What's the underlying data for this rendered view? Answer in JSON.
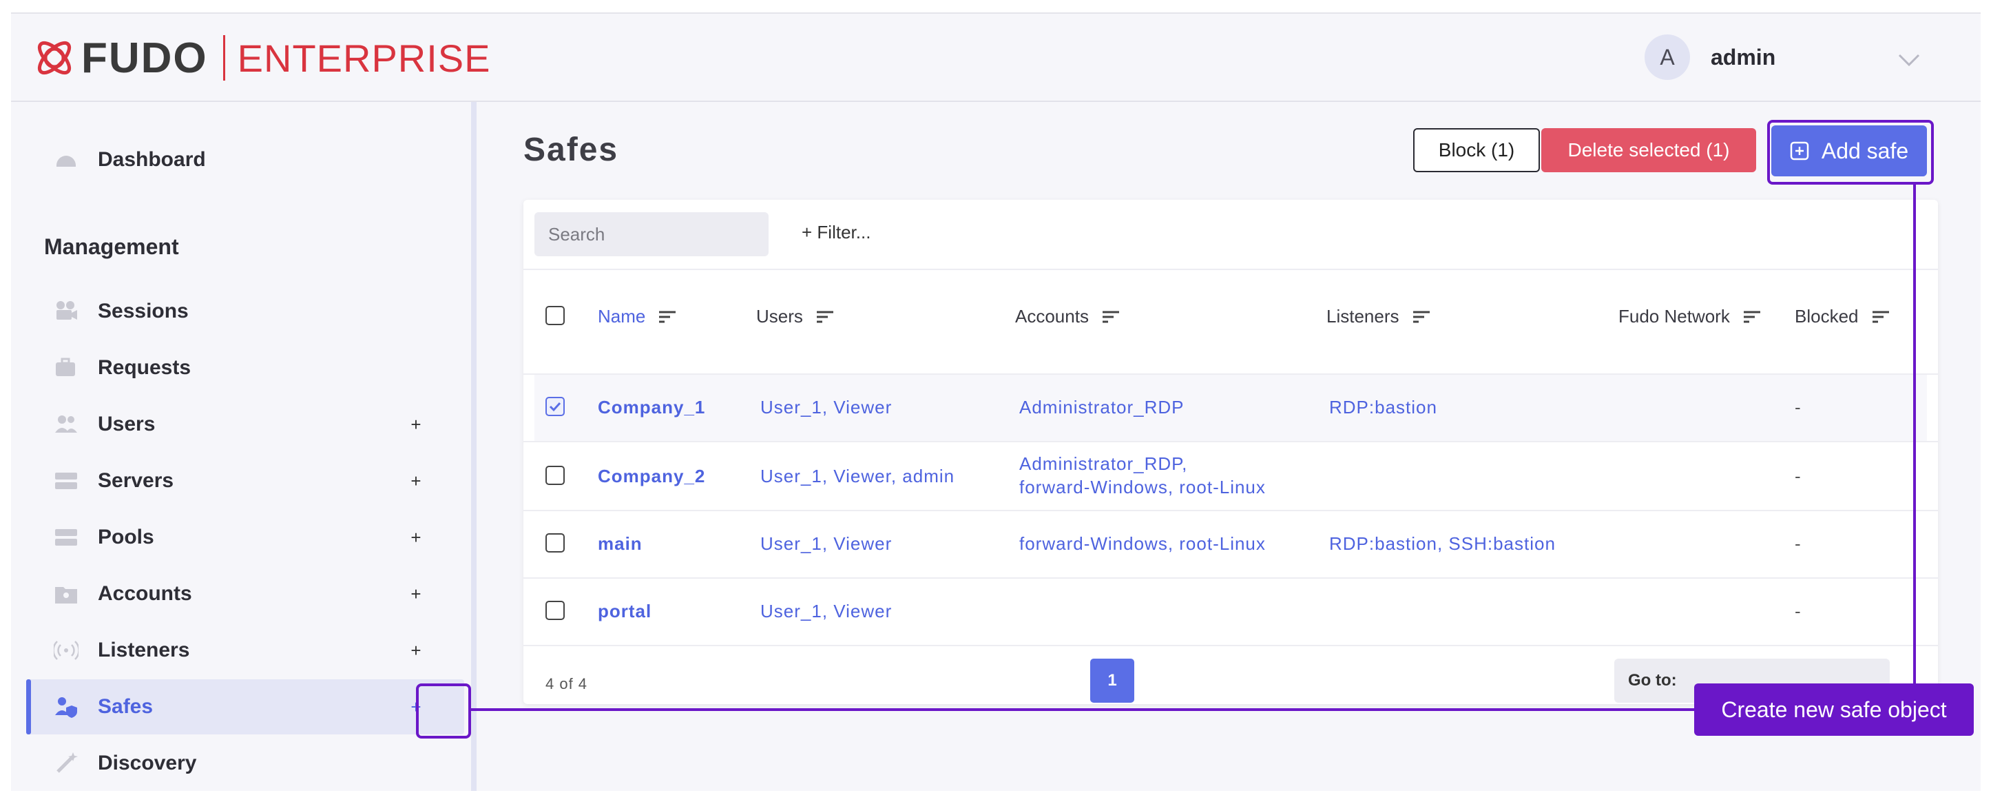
{
  "brand": {
    "name": "FUDO",
    "edition": "ENTERPRISE"
  },
  "user": {
    "initial": "A",
    "name": "admin"
  },
  "sidebar": {
    "dashboard": "Dashboard",
    "section_title": "Management",
    "items": [
      {
        "label": "Sessions",
        "icon": "camera-icon",
        "plus": ""
      },
      {
        "label": "Requests",
        "icon": "briefcase-icon",
        "plus": ""
      },
      {
        "label": "Users",
        "icon": "users-icon",
        "plus": "+"
      },
      {
        "label": "Servers",
        "icon": "server-icon",
        "plus": "+"
      },
      {
        "label": "Pools",
        "icon": "pool-icon",
        "plus": "+"
      },
      {
        "label": "Accounts",
        "icon": "account-icon",
        "plus": "+"
      },
      {
        "label": "Listeners",
        "icon": "listener-icon",
        "plus": "+"
      },
      {
        "label": "Safes",
        "icon": "safe-icon",
        "plus": "+"
      },
      {
        "label": "Discovery",
        "icon": "wand-icon",
        "plus": ""
      }
    ]
  },
  "page": {
    "title": "Safes",
    "block_button": "Block (1)",
    "delete_button": "Delete selected (1)",
    "add_button": "Add safe"
  },
  "toolbar": {
    "search_placeholder": "Search",
    "filter": "+ Filter..."
  },
  "table": {
    "columns": [
      "Name",
      "Users",
      "Accounts",
      "Listeners",
      "Fudo Network",
      "Blocked"
    ],
    "rows": [
      {
        "name": "Company_1",
        "users": "User_1,  Viewer",
        "accounts": "Administrator_RDP",
        "accounts2": "",
        "listeners": "RDP:bastion",
        "network": "",
        "blocked": "-",
        "checked": true
      },
      {
        "name": "Company_2",
        "users": "User_1,  Viewer,  admin",
        "accounts": "Administrator_RDP,",
        "accounts2": "forward-Windows,  root-Linux",
        "listeners": "",
        "network": "",
        "blocked": "-",
        "checked": false
      },
      {
        "name": "main",
        "users": "User_1,  Viewer",
        "accounts": "forward-Windows,  root-Linux",
        "accounts2": "",
        "listeners": "RDP:bastion,  SSH:bastion",
        "network": "",
        "blocked": "-",
        "checked": false
      },
      {
        "name": "portal",
        "users": "User_1,  Viewer",
        "accounts": "",
        "accounts2": "",
        "listeners": "",
        "network": "",
        "blocked": "-",
        "checked": false
      }
    ]
  },
  "pagination": {
    "count": "4 of 4",
    "current_page": "1",
    "goto_label": "Go to:",
    "next": "›"
  },
  "annotation": {
    "text": "Create new safe object"
  },
  "colors": {
    "accent": "#5a6ee6",
    "danger": "#e35567",
    "annotation": "#6a17c8",
    "brand_red": "#d9343f"
  }
}
